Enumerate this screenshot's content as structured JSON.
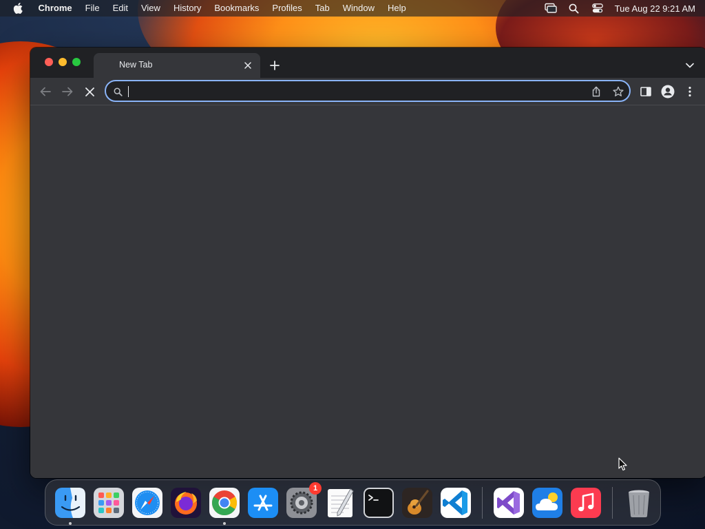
{
  "menubar": {
    "apple_icon": "apple-logo-icon",
    "app_name": "Chrome",
    "items": [
      "File",
      "Edit",
      "View",
      "History",
      "Bookmarks",
      "Profiles",
      "Tab",
      "Window",
      "Help"
    ],
    "status_icons": [
      "screen-mirroring-icon",
      "spotlight-search-icon",
      "control-center-icon"
    ],
    "clock": "Tue Aug 22  9:21 AM"
  },
  "browser": {
    "tab": {
      "title": "New Tab",
      "close_icon": "close-icon"
    },
    "new_tab_icon": "plus-icon",
    "tab_search_icon": "chevron-down-icon",
    "toolbar": {
      "back_icon": "back-arrow-icon",
      "forward_icon": "forward-arrow-icon",
      "stop_icon": "stop-loading-icon",
      "omnibox": {
        "value": "",
        "placeholder": "",
        "focused": true
      },
      "share_icon": "share-icon",
      "bookmark_icon": "star-icon",
      "side_panel_icon": "side-panel-icon",
      "profile_icon": "profile-icon",
      "menu_icon": "kebab-menu-icon"
    },
    "colors": {
      "frame": "#202124",
      "toolbar": "#35363a",
      "focus_ring": "#8ab4f8"
    }
  },
  "dock": {
    "apps": [
      {
        "name": "Finder",
        "icon": "finder-icon",
        "running": true
      },
      {
        "name": "Launchpad",
        "icon": "launchpad-icon",
        "running": false
      },
      {
        "name": "Safari",
        "icon": "safari-icon",
        "running": false
      },
      {
        "name": "Firefox",
        "icon": "firefox-icon",
        "running": false
      },
      {
        "name": "Google Chrome",
        "icon": "chrome-icon",
        "running": true
      },
      {
        "name": "App Store",
        "icon": "app-store-icon",
        "running": false
      },
      {
        "name": "System Settings",
        "icon": "system-settings-icon",
        "running": false,
        "badge": "1"
      },
      {
        "name": "TextEdit",
        "icon": "textedit-icon",
        "running": false
      },
      {
        "name": "Terminal",
        "icon": "terminal-icon",
        "running": false
      },
      {
        "name": "GarageBand",
        "icon": "garageband-icon",
        "running": false
      },
      {
        "name": "Visual Studio Code",
        "icon": "vscode-icon",
        "running": false
      }
    ],
    "recent_apps": [
      {
        "name": "Visual Studio",
        "icon": "visual-studio-icon"
      },
      {
        "name": "iCloud",
        "icon": "cloud-icon"
      },
      {
        "name": "Music",
        "icon": "music-icon"
      }
    ],
    "trash": {
      "name": "Trash",
      "icon": "trash-icon"
    }
  }
}
